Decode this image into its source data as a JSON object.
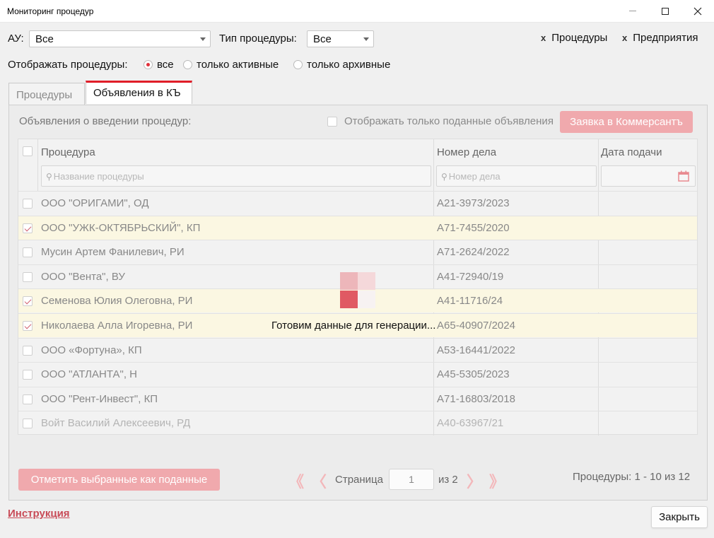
{
  "window": {
    "title": "Мониторинг процедур"
  },
  "filters": {
    "au_label": "АУ:",
    "au_value": "Все",
    "type_label": "Тип процедуры:",
    "type_value": "Все",
    "link_procedures": "Процедуры",
    "link_enterprises": "Предприятия",
    "x_glyph": "x"
  },
  "display": {
    "label": "Отображать процедуры:",
    "options": [
      "все",
      "только активные",
      "только архивные"
    ],
    "selected": "все"
  },
  "tabs": [
    {
      "label": "Процедуры",
      "active": false
    },
    {
      "label": "Объявления в КЪ",
      "active": true
    }
  ],
  "panel": {
    "heading": "Объявления о введении процедур:",
    "only_sent_label": "Отображать только поданные объявления",
    "kommersant_button": "Заявка в Коммерсантъ"
  },
  "grid": {
    "columns": [
      "Процедура",
      "Номер дела",
      "Дата подачи"
    ],
    "filter_placeholders": {
      "name": "Название процедуры",
      "case": "Номер дела"
    },
    "rows": [
      {
        "name": "ООО \"ОРИГАМИ\", ОД",
        "case": "А21-3973/2023",
        "checked": false
      },
      {
        "name": "ООО \"УЖК-ОКТЯБРЬСКИЙ\", КП",
        "case": "А71-7455/2020",
        "checked": true
      },
      {
        "name": "Мусин Артем Фанилевич, РИ",
        "case": "А71-2624/2022",
        "checked": false
      },
      {
        "name": "ООО \"Вента\", ВУ",
        "case": "А41-72940/19",
        "checked": false
      },
      {
        "name": "Семенова Юлия Олеговна, РИ",
        "case": "А41-11716/24",
        "checked": true
      },
      {
        "name": "Николаева Алла Игоревна, РИ",
        "case": "А65-40907/2024",
        "checked": true
      },
      {
        "name": "ООО «Фортуна», КП",
        "case": "А53-16441/2022",
        "checked": false
      },
      {
        "name": "ООО \"АТЛАНТА\", Н",
        "case": "А45-5305/2023",
        "checked": false
      },
      {
        "name": "ООО \"Рент-Инвест\", КП",
        "case": "А71-16803/2018",
        "checked": false
      },
      {
        "name": "Войт Василий Алексеевич, РД",
        "case": "А40-63967/21",
        "checked": false
      }
    ]
  },
  "loader": {
    "text": "Готовим данные для генерации..."
  },
  "footer": {
    "mark_button": "Отметить выбранные как поданные",
    "page_label": "Страница",
    "page_value": "1",
    "page_of": "из 2",
    "first_glyph": "《",
    "prev_glyph": "〈",
    "next_glyph": "〉",
    "last_glyph": "》",
    "count": "Процедуры: 1 - 10 из 12",
    "instruction_link": "Инструкция",
    "close_button": "Закрыть"
  },
  "colors": {
    "accent": "#e01d28",
    "pink_button": "#f0a9ad",
    "selected_row": "#fbf7e2"
  }
}
